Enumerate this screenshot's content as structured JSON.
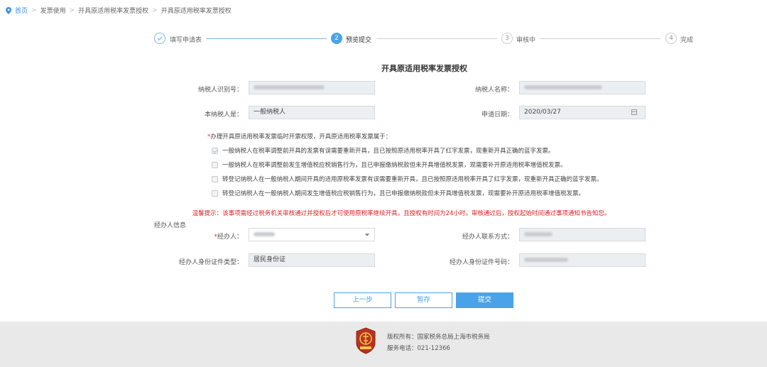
{
  "breadcrumb": {
    "home": "首页",
    "items": [
      "发票使用",
      "开具原适用税率发票授权",
      "开具原适用税率发票授权"
    ]
  },
  "steps": [
    {
      "number": "",
      "label": "填写申请表",
      "state": "done"
    },
    {
      "number": "2",
      "label": "预览提交",
      "state": "active"
    },
    {
      "number": "3",
      "label": "审核中",
      "state": "pending"
    },
    {
      "number": "4",
      "label": "完成",
      "state": "pending"
    }
  ],
  "form": {
    "title": "开具原适用税率发票授权",
    "taxpayer_id_label": "纳税人识别号：",
    "taxpayer_name_label": "纳税人名称：",
    "taxpayer_type_label": "本纳税人是：",
    "taxpayer_type_value": "一般纳税人",
    "apply_date_label": "申请日期：",
    "apply_date_value": "2020/03/27",
    "question_required": "*",
    "question": "办理开具原适用税率发票临时开票权限，开具原适用税率发票属于：",
    "options": [
      {
        "text": "一般纳税人在税率调整前开具的发票有误需要重新开具，且已按照原适用税率开具了红字发票，现重新开具正确的蓝字发票。",
        "checked": true
      },
      {
        "text": "一般纳税人在税率调整前发生增值税应税销售行为，且已申报缴纳税款但未开具增值税发票，现需要补开原适用税率增值税发票。",
        "checked": false
      },
      {
        "text": "转登记纳税人在一般纳税人期间开具的适用原税率发票有误需要重新开具，且已按照原适用税率开具了红字发票，现重新开具正确的蓝字发票。",
        "checked": false
      },
      {
        "text": "转登记纳税人在一般纳税人期间发生增值税应税销售行为，且已申报缴纳税款但未开具增值税发票，现需要补开原适用税率增值税发票。",
        "checked": false
      }
    ],
    "warning": "温馨提示：该事项需经过税务机关审核通过并授权后才可使用原税率继续开具，且授权有时间为24小时，审核通过后，授权起始时间通过事项通知书告知您。",
    "section_title": "经办人信息",
    "agent_required": "*",
    "agent_label": "经办人：",
    "agent_contact_label": "经办人联系方式：",
    "agent_id_type_label": "经办人身份证件类型：",
    "agent_id_type_value": "居民身份证",
    "agent_id_number_label": "经办人身份证件号码："
  },
  "buttons": {
    "prev": "上一步",
    "save": "暂存",
    "submit": "提交"
  },
  "footer": {
    "copyright": "版权所有：国家税务总局上海市税务局",
    "phone": "服务电话：021-12366"
  },
  "colors": {
    "accent": "#4aa3e8",
    "warning": "#e02020",
    "done_check": "#7ab9e6"
  }
}
